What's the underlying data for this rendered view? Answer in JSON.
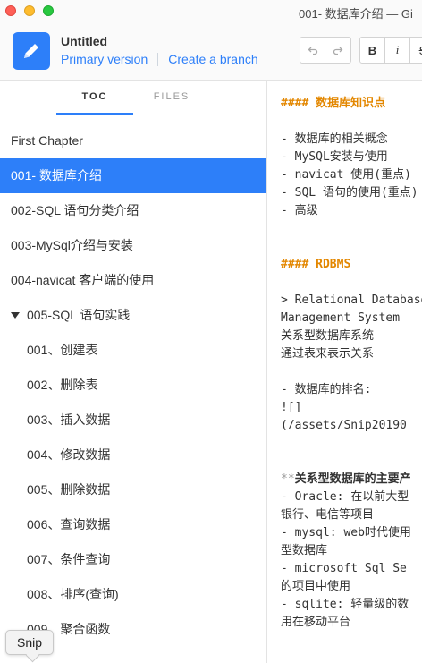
{
  "window": {
    "title": "001- 数据库介绍 — Gi"
  },
  "book": {
    "title": "Untitled",
    "version_link": "Primary version",
    "branch_link": "Create a branch"
  },
  "toolbar": {
    "undo_icon": "undo-icon",
    "redo_icon": "redo-icon",
    "bold_label": "B",
    "italic_label": "i",
    "strike_label": "S"
  },
  "sidebar": {
    "tabs": [
      {
        "label": "TOC",
        "active": true
      },
      {
        "label": "FILES",
        "active": false
      }
    ],
    "items": [
      {
        "label": "First Chapter"
      },
      {
        "label": "001- 数据库介绍",
        "active": true
      },
      {
        "label": "002-SQL 语句分类介绍"
      },
      {
        "label": "003-MySql介绍与安装"
      },
      {
        "label": "004-navicat 客户端的使用"
      },
      {
        "label": "005-SQL 语句实践",
        "expanded": true
      },
      {
        "label": "001、创建表"
      },
      {
        "label": "002、删除表"
      },
      {
        "label": "003、插入数据"
      },
      {
        "label": "004、修改数据"
      },
      {
        "label": "005、删除数据"
      },
      {
        "label": "006、查询数据"
      },
      {
        "label": "007、条件查询"
      },
      {
        "label": "008、排序(查询)"
      },
      {
        "label": "009、聚合函数"
      }
    ]
  },
  "tooltip": {
    "text": "Snip"
  },
  "editor": {
    "lines": [
      {
        "text": "#### 数据库知识点"
      },
      {
        "text": "- 数据库的相关概念"
      },
      {
        "text": "- MySQL安装与使用"
      },
      {
        "text": "- navicat 使用(重点)"
      },
      {
        "text": "- SQL 语句的使用(重点)"
      },
      {
        "text": "- 高级"
      },
      {
        "text": "#### RDBMS"
      },
      {
        "text": "> Relational Database"
      },
      {
        "text": "Management System"
      },
      {
        "text": "关系型数据库系统"
      },
      {
        "text": "通过表来表示关系"
      },
      {
        "text": "- 数据库的排名:"
      },
      {
        "text": "![]"
      },
      {
        "text": "(/assets/Snip20190"
      },
      {
        "marker": "**",
        "text": "关系型数据库的主要产"
      },
      {
        "text": "- Oracle: 在以前大型"
      },
      {
        "text": "银行、电信等项目"
      },
      {
        "text": "- mysql: web时代使用"
      },
      {
        "text": "型数据库"
      },
      {
        "text": "- microsoft Sql Se"
      },
      {
        "text": "的项目中使用"
      },
      {
        "text": "- sqlite: 轻量级的数"
      },
      {
        "text": "用在移动平台"
      }
    ]
  },
  "colors": {
    "accent": "#2d7ff9",
    "heading": "#e38700"
  }
}
